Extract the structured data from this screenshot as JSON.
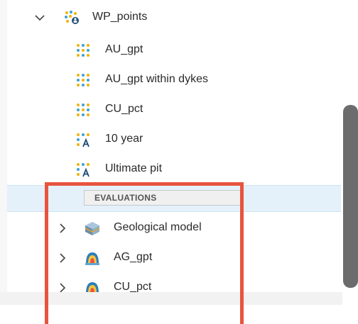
{
  "tree": {
    "group": {
      "label": "WP_points",
      "expanded": true
    },
    "children": [
      {
        "label": "AU_gpt",
        "icon": "points-icon"
      },
      {
        "label": "AU_gpt within dykes",
        "icon": "points-icon"
      },
      {
        "label": "CU_pct",
        "icon": "points-icon"
      },
      {
        "label": "10 year",
        "icon": "points-text-icon"
      },
      {
        "label": "Ultimate pit",
        "icon": "points-text-icon"
      }
    ],
    "section_label": "EVALUATIONS",
    "evaluations": [
      {
        "label": "Geological model",
        "icon": "geological-model-icon"
      },
      {
        "label": "AG_gpt",
        "icon": "evaluation-icon"
      },
      {
        "label": "CU_pct",
        "icon": "evaluation-icon"
      }
    ]
  },
  "colors": {
    "highlight": "#e8543e",
    "selection_band": "#e4f1fb",
    "scrollbar_thumb": "#6c6c6c"
  }
}
